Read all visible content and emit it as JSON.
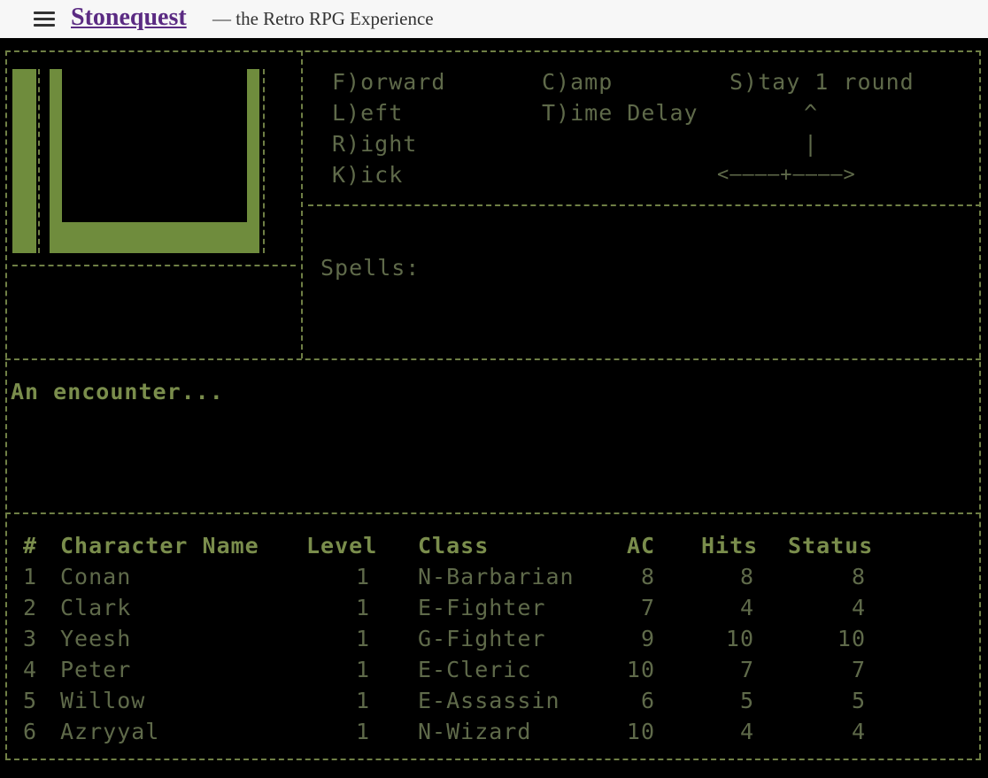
{
  "header": {
    "site_title": "Stonequest",
    "tagline": "— the Retro RPG Experience"
  },
  "commands": {
    "forward": "F)orward",
    "left": "L)eft",
    "right": "R)ight",
    "kick": "K)ick",
    "camp": "C)amp",
    "time_delay": "T)ime Delay",
    "stay": "S)tay 1 round",
    "compass_up": "^",
    "compass_mid": "|",
    "compass_horiz": "<————+————>"
  },
  "spells_label": "Spells:",
  "message": "An encounter...",
  "party": {
    "headers": {
      "num": "#",
      "name": "Character Name",
      "level": "Level",
      "class": "Class",
      "ac": "AC",
      "hits": "Hits",
      "status": "Status"
    },
    "rows": [
      {
        "num": "1",
        "name": "Conan",
        "level": "1",
        "class": "N-Barbarian",
        "ac": "8",
        "hits": "8",
        "status": "8"
      },
      {
        "num": "2",
        "name": "Clark",
        "level": "1",
        "class": "E-Fighter",
        "ac": "7",
        "hits": "4",
        "status": "4"
      },
      {
        "num": "3",
        "name": "Yeesh",
        "level": "1",
        "class": "G-Fighter",
        "ac": "9",
        "hits": "10",
        "status": "10"
      },
      {
        "num": "4",
        "name": "Peter",
        "level": "1",
        "class": "E-Cleric",
        "ac": "10",
        "hits": "7",
        "status": "7"
      },
      {
        "num": "5",
        "name": "Willow",
        "level": "1",
        "class": "E-Assassin",
        "ac": "6",
        "hits": "5",
        "status": "5"
      },
      {
        "num": "6",
        "name": "Azryyal",
        "level": "1",
        "class": "N-Wizard",
        "ac": "10",
        "hits": "4",
        "status": "4"
      }
    ]
  },
  "colors": {
    "background": "#000000",
    "text": "#5f6a4a",
    "maze_wall": "#6f8c3d",
    "border": "#6f7f45",
    "title_link": "#5b2b83"
  }
}
